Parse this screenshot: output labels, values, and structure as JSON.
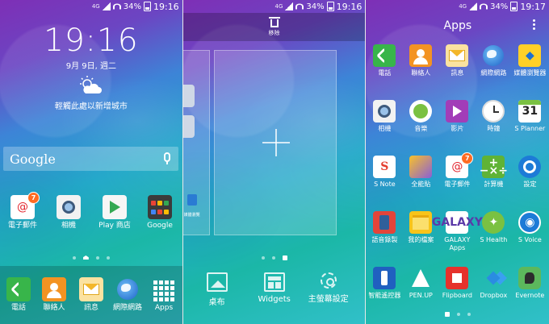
{
  "screens": [
    {
      "status": {
        "net": "4G",
        "net_small": "LTE",
        "battery": "34%",
        "time": "19:16"
      },
      "clock": "19:16",
      "date": "9月 9日, 週二",
      "weather_hint": "輕觸此處以新增城市",
      "weather_icon": "partly-cloudy-icon",
      "search": {
        "brand": "Google",
        "mic_icon": "mic-icon"
      },
      "home_apps": [
        {
          "label": "電子郵件",
          "icon": "email-icon",
          "badge": "7"
        },
        {
          "label": "相機",
          "icon": "camera-icon"
        },
        {
          "label": "Play 商店",
          "icon": "play-store-icon"
        },
        {
          "label": "Google",
          "icon": "google-folder-icon"
        }
      ],
      "dock": [
        {
          "label": "電話",
          "icon": "phone-icon"
        },
        {
          "label": "聯絡人",
          "icon": "contacts-icon"
        },
        {
          "label": "訊息",
          "icon": "messages-icon"
        },
        {
          "label": "網際網路",
          "icon": "internet-icon"
        },
        {
          "label": "Apps",
          "icon": "apps-grid-icon"
        }
      ]
    },
    {
      "status": {
        "net": "4G",
        "net_small": "LTE",
        "battery": "34%",
        "time": "19:16"
      },
      "remove_label": "移除",
      "mini_label": "媒體瀏覽",
      "options": [
        {
          "label": "桌布",
          "icon": "wallpaper-icon"
        },
        {
          "label": "Widgets",
          "icon": "widgets-icon"
        },
        {
          "label": "主螢幕設定",
          "icon": "home-settings-icon"
        }
      ]
    },
    {
      "status": {
        "net": "4G",
        "net_small": "LTE",
        "battery": "34%",
        "time": "19:17"
      },
      "title": "Apps",
      "apps": [
        {
          "label": "電話",
          "icon": "phone-icon"
        },
        {
          "label": "聯絡人",
          "icon": "contacts-icon"
        },
        {
          "label": "訊息",
          "icon": "messages-icon"
        },
        {
          "label": "網際網路",
          "icon": "internet-icon"
        },
        {
          "label": "媒體瀏覽器",
          "icon": "media-browser-icon"
        },
        {
          "label": "相機",
          "icon": "camera-icon"
        },
        {
          "label": "音樂",
          "icon": "music-icon"
        },
        {
          "label": "影片",
          "icon": "video-icon"
        },
        {
          "label": "時鐘",
          "icon": "clock-icon"
        },
        {
          "label": "S Planner",
          "icon": "calendar-icon",
          "text": "31"
        },
        {
          "label": "S Note",
          "icon": "s-note-icon",
          "text": "S"
        },
        {
          "label": "全能貼",
          "icon": "scrapbook-icon"
        },
        {
          "label": "電子郵件",
          "icon": "email-icon",
          "badge": "7"
        },
        {
          "label": "計算機",
          "icon": "calculator-icon",
          "text": "+−×÷"
        },
        {
          "label": "設定",
          "icon": "settings-icon"
        },
        {
          "label": "語音錄製",
          "icon": "voice-recorder-icon"
        },
        {
          "label": "我的檔案",
          "icon": "my-files-icon"
        },
        {
          "label": "GALAXY Apps",
          "icon": "galaxy-apps-icon",
          "text": "GALAXY"
        },
        {
          "label": "S Health",
          "icon": "s-health-icon"
        },
        {
          "label": "S Voice",
          "icon": "s-voice-icon"
        },
        {
          "label": "智能遙控器",
          "icon": "smart-remote-icon"
        },
        {
          "label": "PEN.UP",
          "icon": "penup-icon"
        },
        {
          "label": "Flipboard",
          "icon": "flipboard-icon"
        },
        {
          "label": "Dropbox",
          "icon": "dropbox-icon"
        },
        {
          "label": "Evernote",
          "icon": "evernote-icon"
        }
      ]
    }
  ]
}
